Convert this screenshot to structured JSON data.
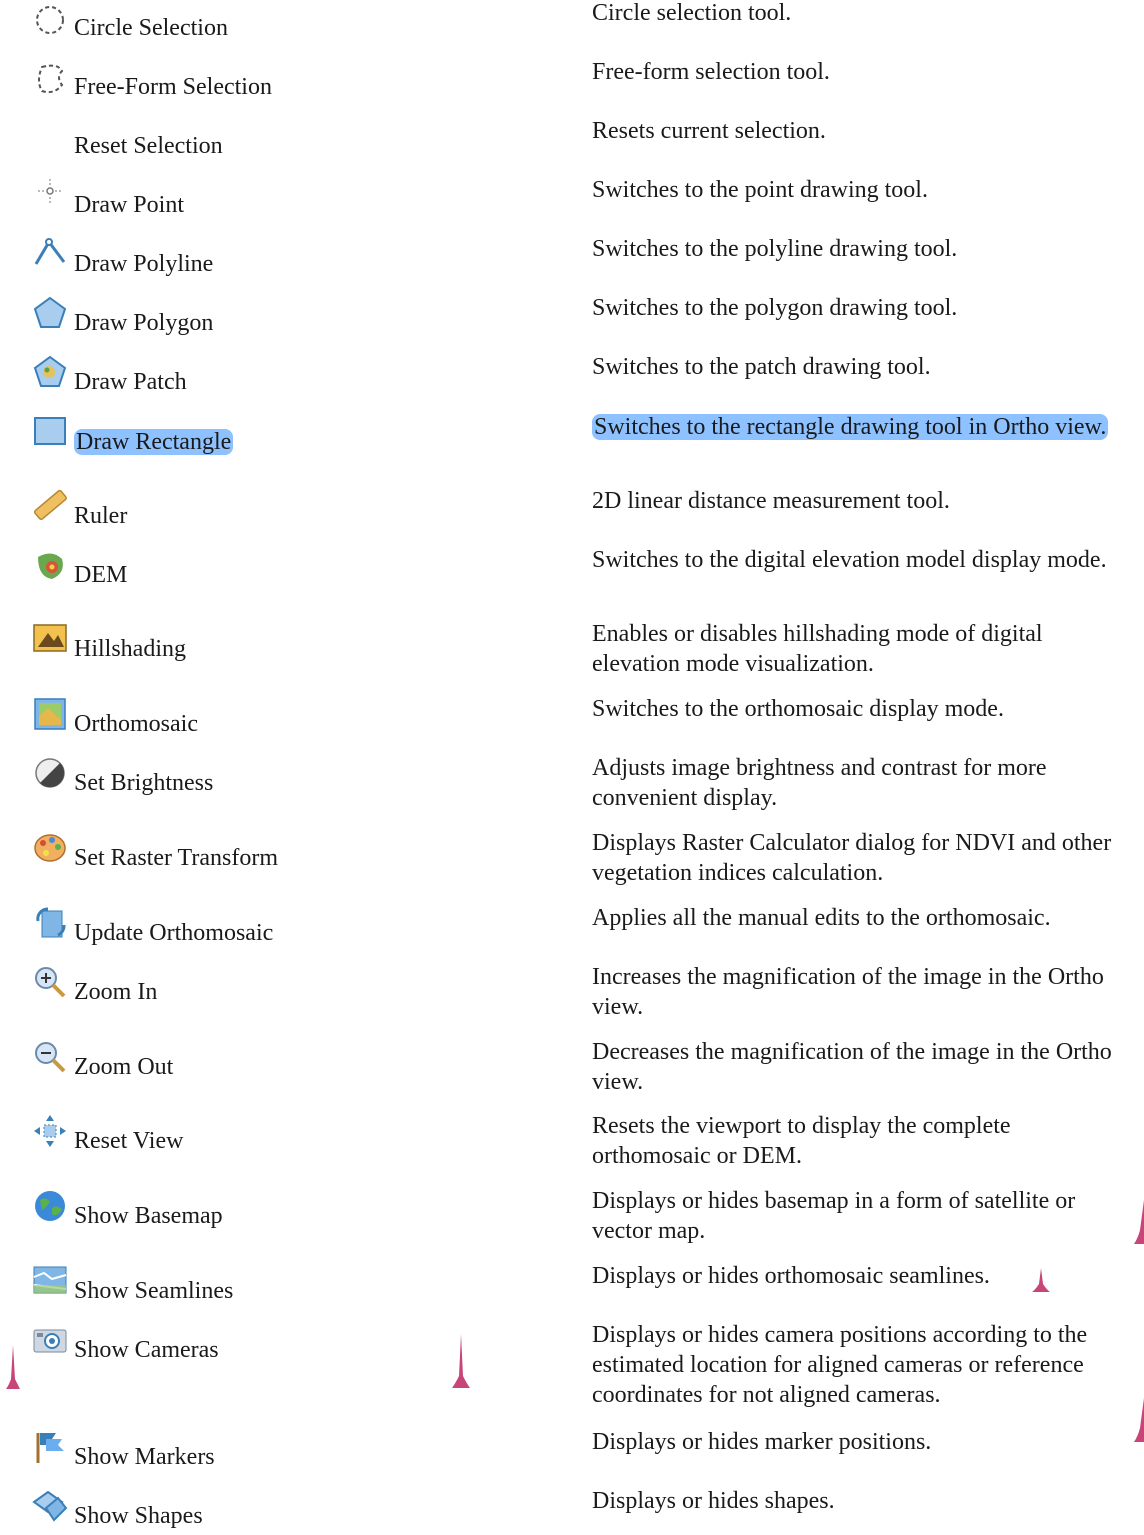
{
  "rows": [
    {
      "label": "Circle Selection",
      "desc": "Circle selection tool.",
      "icon": "circle-selection-icon"
    },
    {
      "label": "Free-Form Selection",
      "desc": "Free-form selection tool.",
      "icon": "free-form-selection-icon"
    },
    {
      "label": "Reset Selection",
      "desc": "Resets current selection.",
      "icon": ""
    },
    {
      "label": "Draw Point",
      "desc": "Switches to the point drawing tool.",
      "icon": "draw-point-icon"
    },
    {
      "label": "Draw Polyline",
      "desc": "Switches to the polyline drawing tool.",
      "icon": "draw-polyline-icon"
    },
    {
      "label": "Draw Polygon",
      "desc": "Switches to the polygon drawing tool.",
      "icon": "draw-polygon-icon"
    },
    {
      "label": "Draw Patch",
      "desc": "Switches to the patch drawing tool.",
      "icon": "draw-patch-icon"
    },
    {
      "label": "Draw Rectangle",
      "desc": "Switches to the rectangle drawing tool in Ortho view.",
      "icon": "draw-rectangle-icon",
      "highlighted": true
    },
    {
      "label": "Ruler",
      "desc": "2D linear distance measurement tool.",
      "icon": "ruler-icon"
    },
    {
      "label": "DEM",
      "desc": "Switches to the digital elevation model display mode.",
      "icon": "dem-icon"
    },
    {
      "label": "Hillshading",
      "desc": "Enables or disables hillshading mode of digital elevation mode visualization.",
      "icon": "hillshading-icon"
    },
    {
      "label": "Orthomosaic",
      "desc": "Switches to the orthomosaic display mode.",
      "icon": "orthomosaic-icon"
    },
    {
      "label": "Set Brightness",
      "desc": "Adjusts image brightness and contrast for more convenient display.",
      "icon": "brightness-icon"
    },
    {
      "label": "Set Raster Transform",
      "desc": "Displays Raster Calculator dialog for NDVI and other vegetation indices calculation.",
      "icon": "raster-transform-icon"
    },
    {
      "label": "Update Orthomosaic",
      "desc": "Applies all the manual edits to the orthomosaic.",
      "icon": "update-orthomosaic-icon"
    },
    {
      "label": "Zoom In",
      "desc": "Increases the magnification of the image in the Ortho view.",
      "icon": "zoom-in-icon"
    },
    {
      "label": "Zoom Out",
      "desc": "Decreases the magnification of the image in the Ortho view.",
      "icon": "zoom-out-icon"
    },
    {
      "label": "Reset View",
      "desc": "Resets the viewport to display the complete orthomosaic or DEM.",
      "icon": "reset-view-icon"
    },
    {
      "label": "Show Basemap",
      "desc": "Displays or hides basemap in a form of satellite or vector map.",
      "icon": "basemap-icon"
    },
    {
      "label": "Show Seamlines",
      "desc": "Displays or hides orthomosaic seamlines.",
      "icon": "seamlines-icon"
    },
    {
      "label": "Show Cameras",
      "desc": "Displays or hides camera positions according to the estimated location for aligned cameras or reference coordinates for not aligned cameras.",
      "icon": "cameras-icon"
    },
    {
      "label": "Show Markers",
      "desc": "Displays or hides marker positions.",
      "icon": "markers-icon"
    },
    {
      "label": "Show Shapes",
      "desc": "Displays or hides shapes.",
      "icon": "shapes-icon"
    }
  ],
  "colors": {
    "highlight": "#8ec1ff",
    "mark": "#c8457a"
  }
}
